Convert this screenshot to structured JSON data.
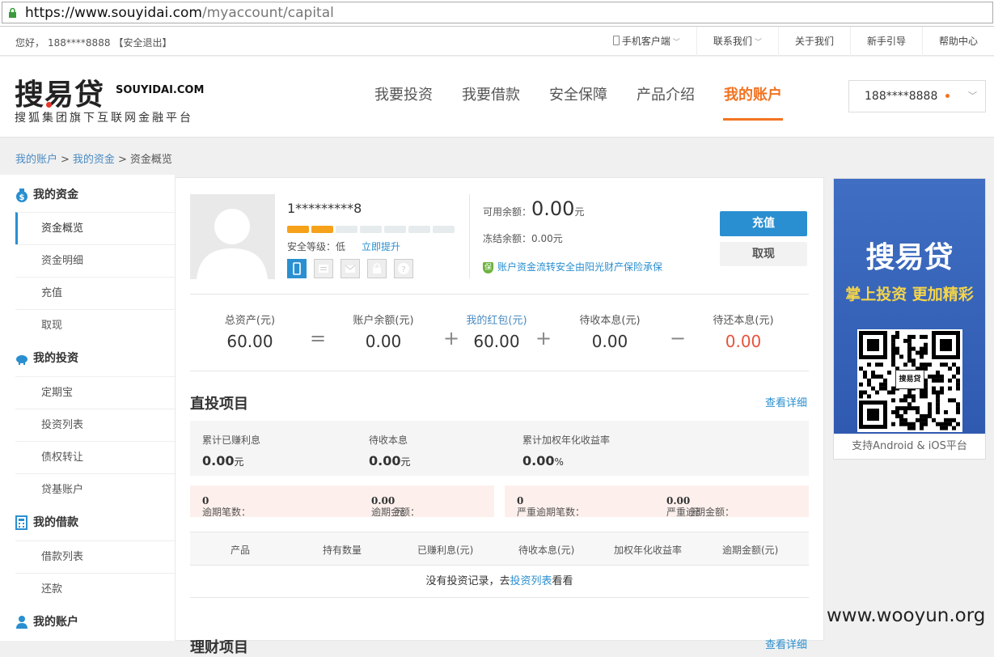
{
  "browser": {
    "url_scheme": "https",
    "url_host": "://www.souyidai.com",
    "url_path": "/myaccount/capital"
  },
  "topbar": {
    "greeting": "您好，",
    "phone": "188****8888",
    "logout": "【安全退出】",
    "links": [
      "手机客户端",
      "联系我们",
      "关于我们",
      "新手引导",
      "帮助中心"
    ]
  },
  "header": {
    "logo_cn": "搜易贷",
    "logo_en": "SOUYIDAI.COM",
    "logo_sub": "搜狐集团旗下互联网金融平台",
    "nav": [
      "我要投资",
      "我要借款",
      "安全保障",
      "产品介绍",
      "我的账户"
    ],
    "user": "188****8888"
  },
  "breadcrumb": {
    "a": "我的账户",
    "b": "我的资金",
    "c": "资金概览",
    "sep": ">"
  },
  "sidebar": {
    "g1": "我的资金",
    "g1_items": [
      "资金概览",
      "资金明细",
      "充值",
      "取现"
    ],
    "g2": "我的投资",
    "g2_items": [
      "定期宝",
      "投资列表",
      "债权转让",
      "贷基账户"
    ],
    "g3": "我的借款",
    "g3_items": [
      "借款列表",
      "还款"
    ],
    "g4": "我的账户"
  },
  "account": {
    "username": "1*********8",
    "security_bars": 2,
    "security_total": 7,
    "sec_label": "安全等级：低",
    "sec_upgrade": "立即提升",
    "avail_label": "可用余额：",
    "avail_value": "0.00",
    "avail_unit": "元",
    "frozen": "冻结余额：0.00元",
    "insurance": "账户资金流转安全由阳光财产保险承保",
    "recharge": "充值",
    "withdraw": "取现"
  },
  "summary": {
    "labels": [
      "总资产(元)",
      "账户余额(元)",
      "我的红包(元)",
      "待收本息(元)",
      "待还本息(元)"
    ],
    "values": [
      "60.00",
      "0.00",
      "60.00",
      "0.00",
      "0.00"
    ],
    "ops": [
      "=",
      "+",
      "+",
      "−"
    ]
  },
  "direct": {
    "title": "直投项目",
    "more": "查看详细",
    "stats": [
      {
        "label": "累计已赚利息",
        "value": "0.00",
        "unit": "元"
      },
      {
        "label": "待收本息",
        "value": "0.00",
        "unit": "元"
      },
      {
        "label": "累计加权年化收益率",
        "value": "0.00",
        "unit": "%"
      }
    ],
    "overdue": [
      {
        "l": "逾期笔数：",
        "v": "0",
        "u": ""
      },
      {
        "l": "逾期金额：",
        "v": "0.00",
        "u": "元"
      },
      {
        "l": "严重逾期笔数：",
        "v": "0",
        "u": ""
      },
      {
        "l": "严重逾期金额：",
        "v": "0.00",
        "u": "元"
      }
    ],
    "columns": [
      "产品",
      "持有数量",
      "已赚利息(元)",
      "待收本息(元)",
      "加权年化收益率",
      "逾期金额(元)"
    ],
    "empty_a": "没有投资记录，去",
    "empty_link": "投资列表",
    "empty_b": "看看"
  },
  "section2": {
    "title": "理财项目",
    "more": "查看详细"
  },
  "ad": {
    "brand": "搜易贷",
    "slogan": "掌上投资 更加精彩",
    "qr_label": "搜易贷",
    "footer": "支持Android & iOS平台"
  },
  "watermark": "www.wooyun.org",
  "colors": {
    "accent": "#f27321",
    "link": "#2a8fd0",
    "danger": "#e8533b"
  }
}
